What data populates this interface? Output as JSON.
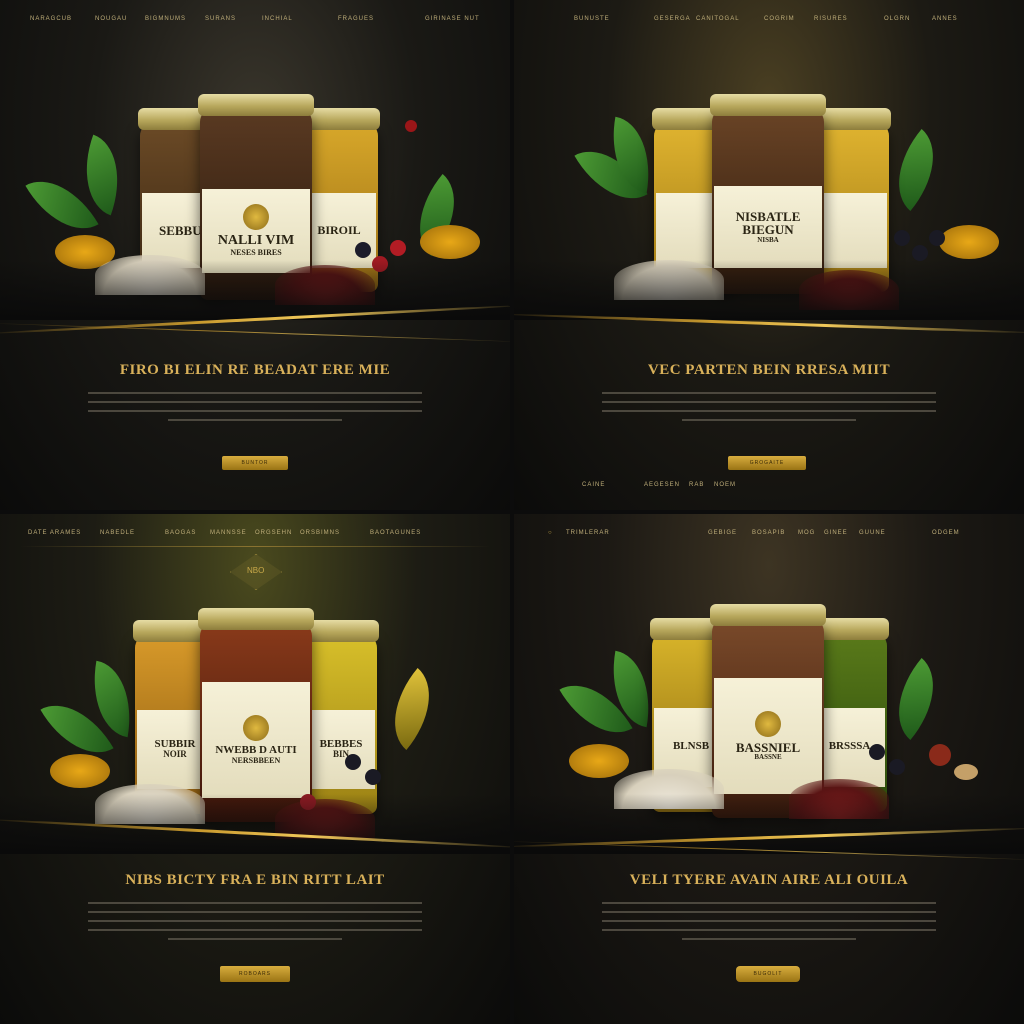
{
  "panels": [
    {
      "nav": [
        "NARAGCUB",
        "NOUGAU",
        "BIGMNUMS",
        "SURANS",
        "INCHIAL",
        "FRAGUES",
        "GIRINASE NUT"
      ],
      "jar_labels": [
        "SEBBUR",
        "NALLI VIM",
        "BIROIL"
      ],
      "jar_sublabels": [
        "NESES BIRES"
      ],
      "headline": "FIRO BI ELIN RE BEADAT ERE MIE",
      "cta": "BUNTOR"
    },
    {
      "nav": [
        "BUNUSTE",
        "GESERGA",
        "CANITOGAL",
        "COGRIM",
        "RISURES",
        "OLGRN",
        "ANNES"
      ],
      "jar_labels": [
        "NISBATLE",
        "BIEGUN"
      ],
      "jar_sublabels": [
        "NISBA"
      ],
      "headline": "VEC PARTEN BEIN RRESA MIIT",
      "cta": "GROGAITE",
      "footer_nav": [
        "CAINE",
        "AEGESEN",
        "RAB",
        "NOEM"
      ]
    },
    {
      "nav": [
        "DATE ARAMES",
        "NABEDLE",
        "BAOGAS",
        "MANNSSE",
        "ORGSEHN",
        "ORSBIMNS",
        "BAOTAGUNES"
      ],
      "emblem": "NBO",
      "jar_labels": [
        "SUBBIR",
        "NWEBB D AUTI",
        "BEBBES"
      ],
      "jar_sublabels": [
        "NOIR",
        "NERSBBEEN",
        "BIN"
      ],
      "headline": "NIBS BICTY FRA E BIN RITT LAIT",
      "cta": "ROBOARS"
    },
    {
      "nav": [
        "TRIMLERAR",
        "GEBIGE",
        "BOSAPIB",
        "MOG",
        "GINEE",
        "GUUNE",
        "ODGEM"
      ],
      "jar_labels": [
        "BLNSB",
        "BASSNIEL",
        "BRSSSA"
      ],
      "jar_sublabels": [
        "BASSNE"
      ],
      "headline": "VELI TYERE AVAIN AIRE ALI OUILA",
      "cta": "BUGOLIT"
    }
  ],
  "colors": {
    "gold": "#d9b15a",
    "cta": "#c49a2e",
    "bg": "#0c0c0c"
  }
}
